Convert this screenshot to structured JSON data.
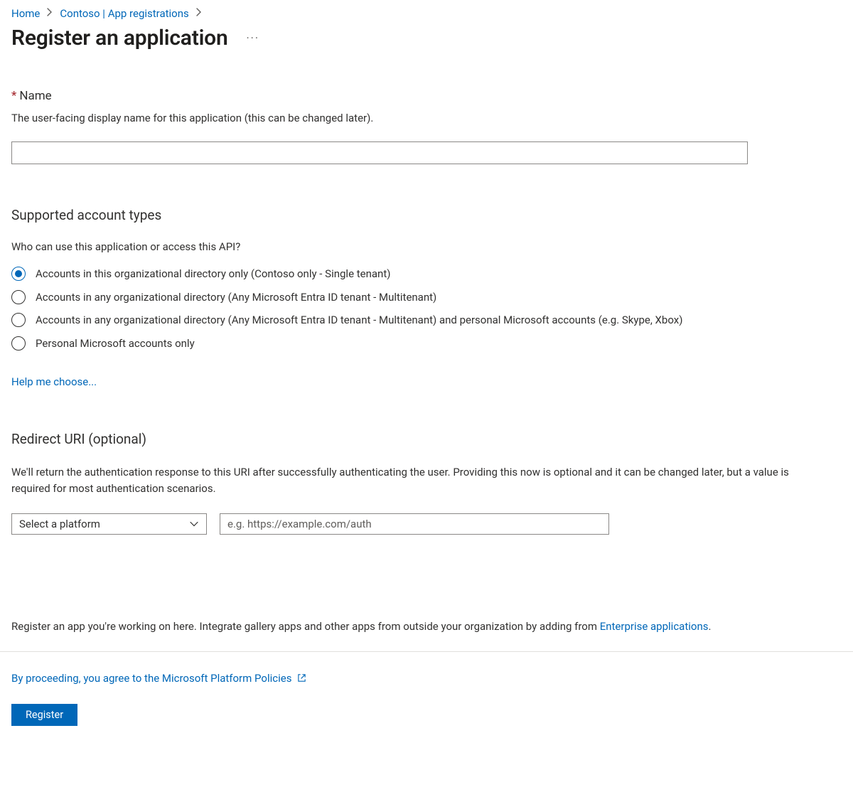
{
  "breadcrumb": {
    "home": "Home",
    "tenant": "Contoso | App registrations"
  },
  "title": "Register an application",
  "name_section": {
    "label": "Name",
    "desc": "The user-facing display name for this application (this can be changed later).",
    "value": ""
  },
  "account_types": {
    "heading": "Supported account types",
    "sub": "Who can use this application or access this API?",
    "options": [
      "Accounts in this organizational directory only (Contoso only - Single tenant)",
      "Accounts in any organizational directory (Any Microsoft Entra ID tenant - Multitenant)",
      "Accounts in any organizational directory (Any Microsoft Entra ID tenant - Multitenant) and personal Microsoft accounts (e.g. Skype, Xbox)",
      "Personal Microsoft accounts only"
    ],
    "selected_index": 0,
    "help_link": "Help me choose..."
  },
  "redirect_uri": {
    "heading": "Redirect URI (optional)",
    "desc": "We'll return the authentication response to this URI after successfully authenticating the user. Providing this now is optional and it can be changed later, but a value is required for most authentication scenarios.",
    "platform_placeholder": "Select a platform",
    "uri_placeholder": "e.g. https://example.com/auth",
    "platform_value": "",
    "uri_value": ""
  },
  "bottom_note": {
    "prefix": "Register an app you're working on here. Integrate gallery apps and other apps from outside your organization by adding from ",
    "link": "Enterprise applications",
    "suffix": "."
  },
  "policy_link": "By proceeding, you agree to the Microsoft Platform Policies",
  "register_button": "Register"
}
